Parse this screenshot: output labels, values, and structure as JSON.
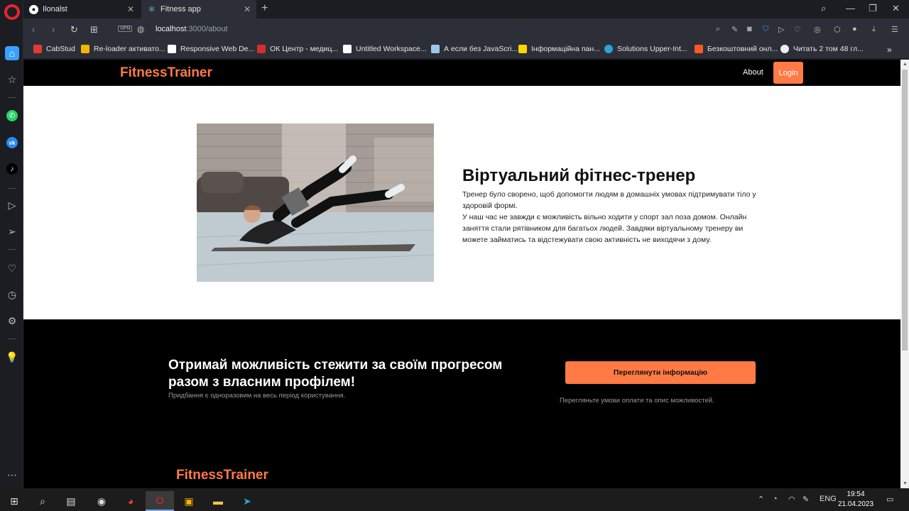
{
  "browser": {
    "tabs": [
      {
        "label": "Ilonalst",
        "icon": "github-icon"
      },
      {
        "label": "Fitness app",
        "icon": "react-icon"
      }
    ],
    "url_host": "localhost",
    "url_path": ":3000/about",
    "vpn_label": "VPN",
    "bookmarks": [
      {
        "label": "CabStud",
        "color": "#e53935"
      },
      {
        "label": "Re-loader активато...",
        "color": "#f4b400"
      },
      {
        "label": "Responsive Web De...",
        "color": "#ffffff"
      },
      {
        "label": "ОК Центр - медиц...",
        "color": "#d32f2f"
      },
      {
        "label": "Untitled Workspace...",
        "color": "#ffffff"
      },
      {
        "label": "А если без JavaScri...",
        "color": "#9ec5e8"
      },
      {
        "label": "Інформаційна пан...",
        "color": "#ffd500"
      },
      {
        "label": "Solutions Upper-Int...",
        "color": "#2aa4d8"
      },
      {
        "label": "Безкоштовний онл...",
        "color": "#ff5722"
      },
      {
        "label": "Читать 2 том 48 гл...",
        "color": "#eeeeee"
      }
    ]
  },
  "site": {
    "brand": "FitnessTrainer",
    "nav": {
      "about": "About",
      "login": "Login"
    },
    "hero": {
      "title": "Віртуальний фітнес-тренер",
      "p1": "Тренер було сворено, щоб допомогти людям в домашніх умовах підтримувати тіло у здоровій формі.",
      "p2": "У наш час не завжди є можливість вільно ходити у спорт зал поза домом. Онлайн заняття стали рятівником для багатьох людей. Завдяки віртуальному тренеру ви можете займатись та відстежувати свою активність не виходячи з дому."
    },
    "cta": {
      "title": "Отримай можливість стежити за своїм прогресом разом з власним профілем!",
      "subtitle": "Придбання є одноразовим на весь період користування.",
      "button": "Переглянути інформацію",
      "note": "Перегляньте умови оплати та опис можливостей."
    },
    "footer_brand": "FitnessTrainer"
  },
  "taskbar": {
    "lang": "ENG",
    "time": "19:54",
    "date": "21.04.2023"
  },
  "colors": {
    "accent": "#ff7a45",
    "dark": "#000000"
  }
}
